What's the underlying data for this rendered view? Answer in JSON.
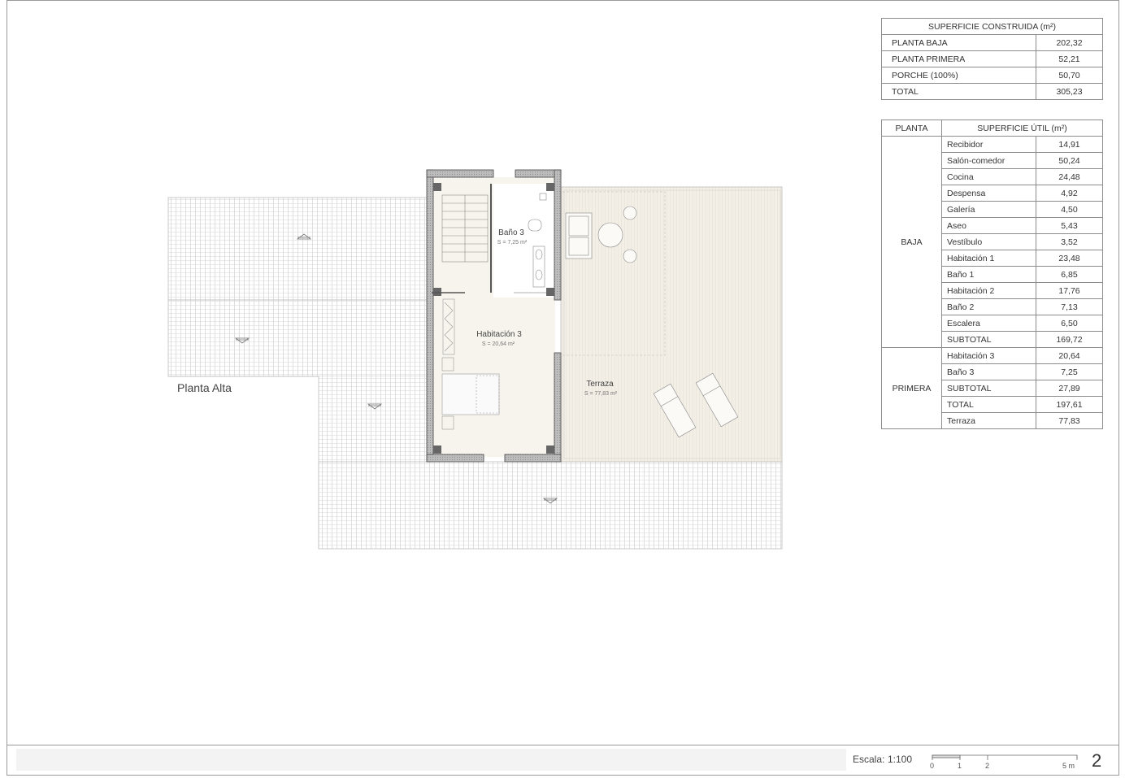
{
  "plan_title": "Planta Alta",
  "rooms": {
    "bano3": {
      "name": "Baño 3",
      "area": "S = 7,25 m²"
    },
    "habitacion3": {
      "name": "Habitación 3",
      "area": "S = 20,64 m²"
    },
    "terraza": {
      "name": "Terraza",
      "area": "S = 77,83 m²"
    }
  },
  "constructed_table": {
    "header": "SUPERFICIE CONSTRUIDA (m²)",
    "rows": [
      {
        "label": "PLANTA BAJA",
        "value": "202,32"
      },
      {
        "label": "PLANTA PRIMERA",
        "value": "52,21"
      },
      {
        "label": "PORCHE (100%)",
        "value": "50,70"
      },
      {
        "label": "TOTAL",
        "value": "305,23"
      }
    ]
  },
  "useful_table": {
    "header_planta": "PLANTA",
    "header_surface": "SUPERFICIE ÚTIL (m²)",
    "baja_label": "BAJA",
    "primera_label": "PRIMERA",
    "baja_rows": [
      {
        "room": "Recibidor",
        "value": "14,91"
      },
      {
        "room": "Salón-comedor",
        "value": "50,24"
      },
      {
        "room": "Cocina",
        "value": "24,48"
      },
      {
        "room": "Despensa",
        "value": "4,92"
      },
      {
        "room": "Galería",
        "value": "4,50"
      },
      {
        "room": "Aseo",
        "value": "5,43"
      },
      {
        "room": "Vestíbulo",
        "value": "3,52"
      },
      {
        "room": "Habitación 1",
        "value": "23,48"
      },
      {
        "room": "Baño 1",
        "value": "6,85"
      },
      {
        "room": "Habitación 2",
        "value": "17,76"
      },
      {
        "room": "Baño 2",
        "value": "7,13"
      },
      {
        "room": "Escalera",
        "value": "6,50"
      },
      {
        "room": "SUBTOTAL",
        "value": "169,72"
      }
    ],
    "primera_rows": [
      {
        "room": "Habitación 3",
        "value": "20,64"
      },
      {
        "room": "Baño 3",
        "value": "7,25"
      },
      {
        "room": "SUBTOTAL",
        "value": "27,89"
      },
      {
        "room": "TOTAL",
        "value": "197,61"
      },
      {
        "room": "Terraza",
        "value": "77,83"
      }
    ]
  },
  "scale": {
    "label": "Escala:",
    "value": "1:100",
    "ticks": [
      "0",
      "1",
      "2",
      "5 m"
    ]
  },
  "page_number": "2"
}
